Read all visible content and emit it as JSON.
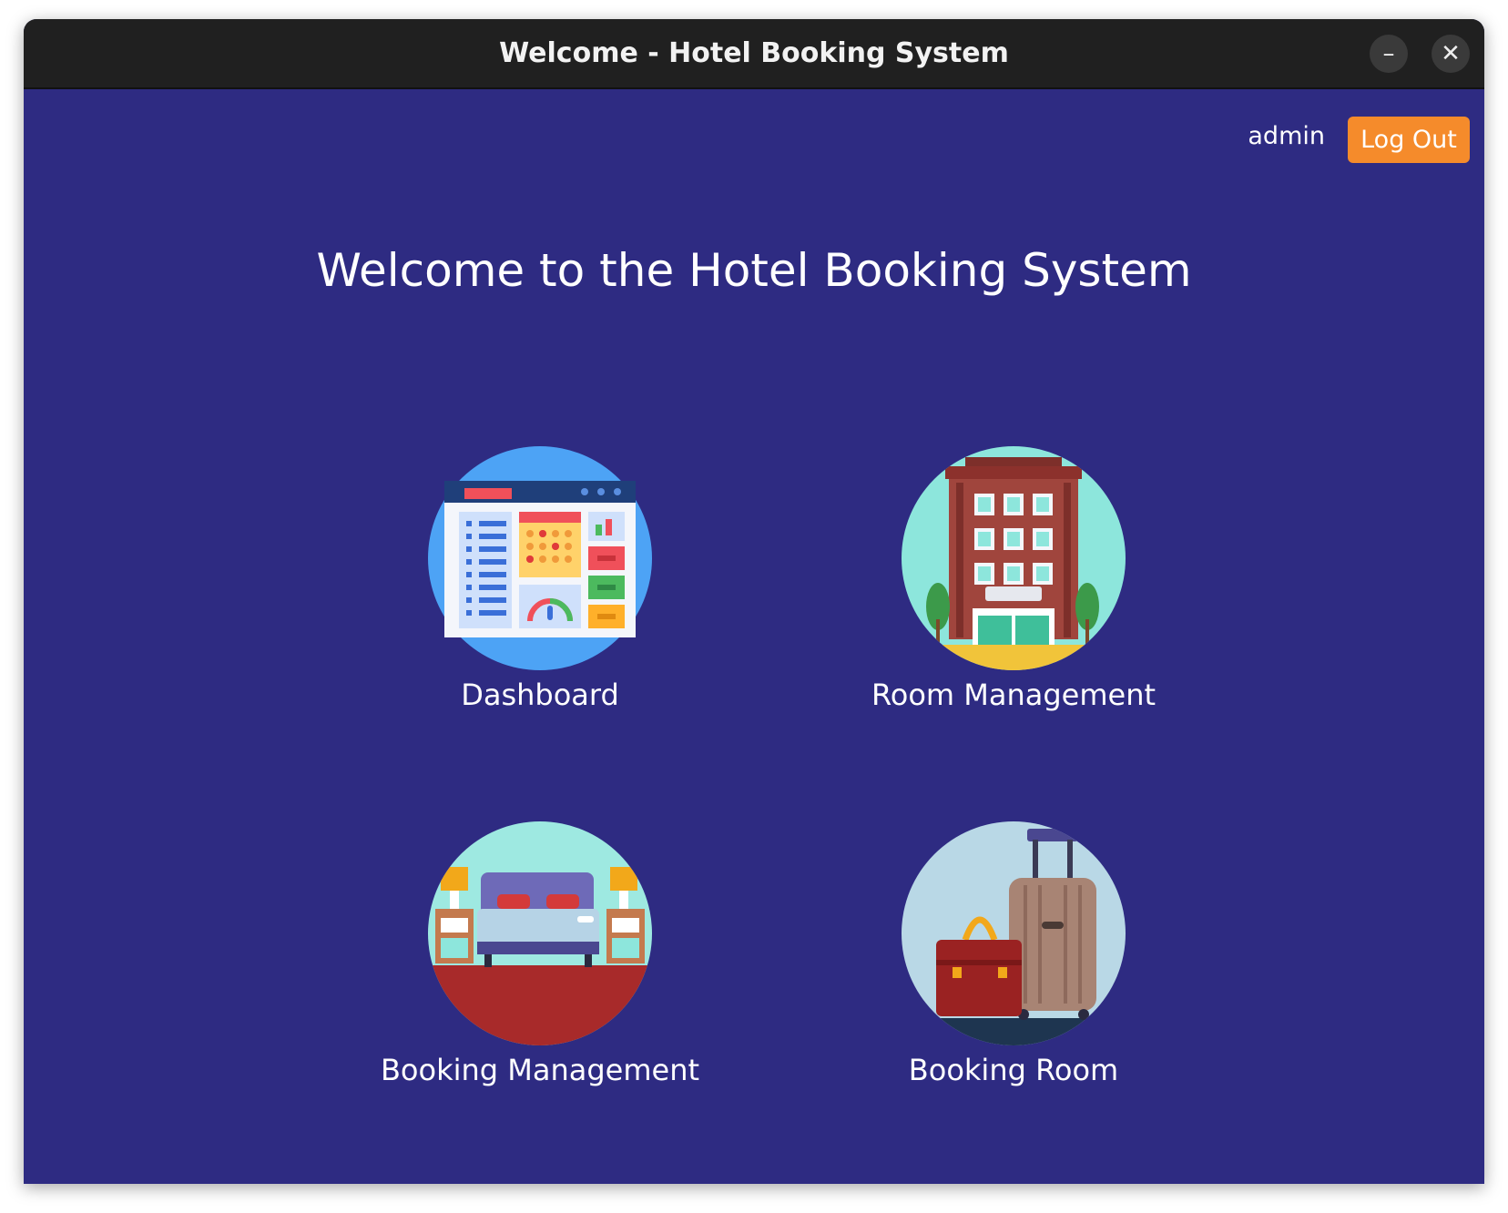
{
  "window": {
    "title": "Welcome - Hotel Booking System",
    "minimize_glyph": "–",
    "close_glyph": "✕"
  },
  "header": {
    "username": "admin",
    "logout_label": "Log Out"
  },
  "main": {
    "heading": "Welcome to the Hotel Booking System",
    "tiles": [
      {
        "label": "Dashboard",
        "icon": "dashboard-icon"
      },
      {
        "label": "Room Management",
        "icon": "hotel-building-icon"
      },
      {
        "label": "Booking Management",
        "icon": "bed-icon"
      },
      {
        "label": "Booking Room",
        "icon": "luggage-icon"
      }
    ]
  },
  "colors": {
    "background": "#2e2b82",
    "titlebar": "#202020",
    "accent": "#f58b2b"
  }
}
